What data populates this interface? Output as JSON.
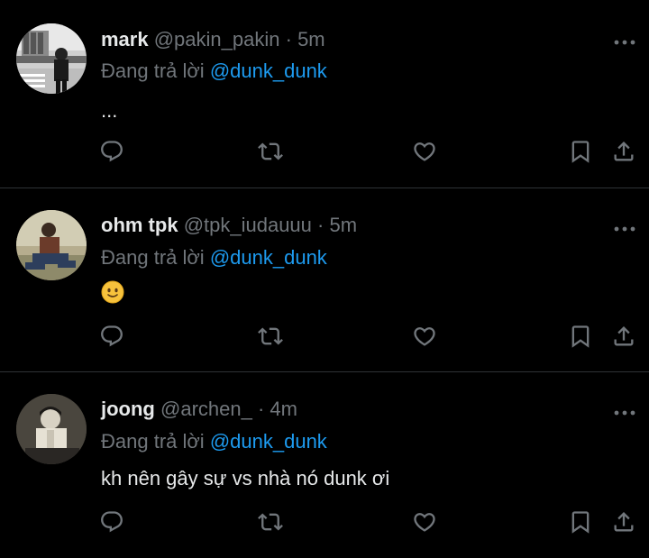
{
  "colors": {
    "background": "#000000",
    "text": "#e7e9ea",
    "muted": "#71767b",
    "mention": "#1d9bf0",
    "divider": "#2f3336"
  },
  "tweets": [
    {
      "name": "mark",
      "handle": "@pakin_pakin",
      "separator": "·",
      "time": "5m",
      "reply_prefix": "Đang trả lời",
      "reply_to": "@dunk_dunk",
      "text": "...",
      "actions": [
        "reply-icon",
        "retweet-icon",
        "like-icon",
        "bookmark-icon",
        "share-icon"
      ]
    },
    {
      "name": "ohm tpk",
      "handle": "@tpk_iudauuu",
      "separator": "·",
      "time": "5m",
      "reply_prefix": "Đang trả lời",
      "reply_to": "@dunk_dunk",
      "text": "🙂",
      "actions": [
        "reply-icon",
        "retweet-icon",
        "like-icon",
        "bookmark-icon",
        "share-icon"
      ]
    },
    {
      "name": "joong",
      "handle": "@archen_",
      "separator": "·",
      "time": "4m",
      "reply_prefix": "Đang trả lời",
      "reply_to": "@dunk_dunk",
      "text": "kh nên gây sự vs nhà nó dunk ơi",
      "actions": [
        "reply-icon",
        "retweet-icon",
        "like-icon",
        "bookmark-icon",
        "share-icon"
      ]
    }
  ]
}
